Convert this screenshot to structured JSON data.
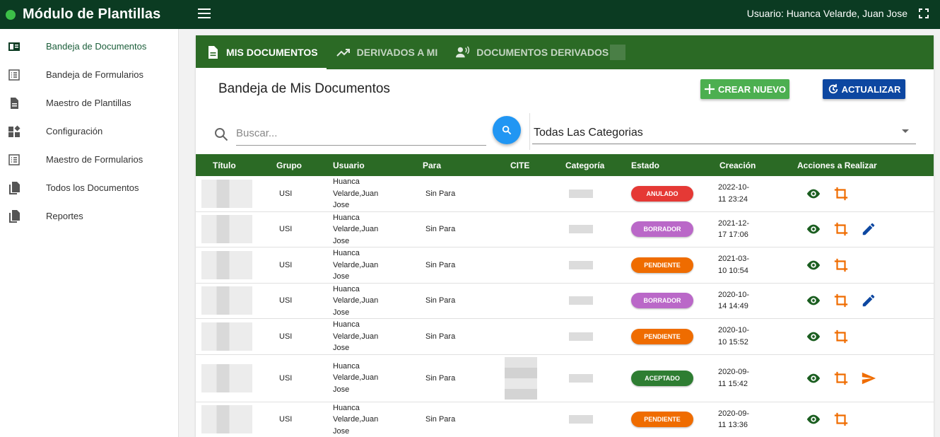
{
  "app": {
    "title": "Módulo de Plantillas",
    "user": "Usuario: Huanca Velarde, Juan Jose",
    "brand_color": "#0b3b22",
    "status_color": "#3cc048"
  },
  "sidebar": {
    "items": [
      {
        "label": "Bandeja de Documentos",
        "icon": "tray-icon",
        "active": true
      },
      {
        "label": "Bandeja de Formularios",
        "icon": "list-icon"
      },
      {
        "label": "Maestro de Plantillas",
        "icon": "document-icon"
      },
      {
        "label": "Configuración",
        "icon": "widgets-icon"
      },
      {
        "label": "Maestro de Formularios",
        "icon": "list-icon"
      },
      {
        "label": "Todos los Documentos",
        "icon": "copy-icon"
      },
      {
        "label": "Reportes",
        "icon": "copy-icon"
      }
    ]
  },
  "tabs": [
    {
      "label": "MIS DOCUMENTOS",
      "icon": "document-icon",
      "active": true
    },
    {
      "label": "DERIVADOS A MI",
      "icon": "trending-icon"
    },
    {
      "label": "DOCUMENTOS DERIVADOS",
      "icon": "voice-person-icon"
    }
  ],
  "main": {
    "title": "Bandeja de Mis Documentos",
    "new_button": "CREAR NUEVO",
    "refresh_button": "ACTUALIZAR",
    "search_placeholder": "Buscar...",
    "category_selected": "Todas Las Categorias"
  },
  "table": {
    "headers": [
      "Título",
      "Grupo",
      "Usuario",
      "Para",
      "CITE",
      "Categoría",
      "Estado",
      "Creación",
      "Acciones a Realizar"
    ],
    "rows": [
      {
        "grupo": "USI",
        "usuario": [
          "Huanca",
          "Velarde,Juan",
          "Jose"
        ],
        "para": "Sin Para",
        "estado": "ANULADO",
        "estado_color": "#e53935",
        "creacion": [
          "2022-10-",
          "11 23:24"
        ],
        "actions": [
          "eye",
          "crop"
        ]
      },
      {
        "grupo": "USI",
        "usuario": [
          "Huanca",
          "Velarde,Juan",
          "Jose"
        ],
        "para": "Sin Para",
        "estado": "BORRADOR",
        "estado_color": "#ba68c8",
        "creacion": [
          "2021-12-",
          "17 17:06"
        ],
        "actions": [
          "eye",
          "crop",
          "edit"
        ]
      },
      {
        "grupo": "USI",
        "usuario": [
          "Huanca",
          "Velarde,Juan",
          "Jose"
        ],
        "para": "Sin Para",
        "estado": "PENDIENTE",
        "estado_color": "#ef6c00",
        "creacion": [
          "2021-03-",
          "10 10:54"
        ],
        "actions": [
          "eye",
          "crop"
        ]
      },
      {
        "grupo": "USI",
        "usuario": [
          "Huanca",
          "Velarde,Juan",
          "Jose"
        ],
        "para": "Sin Para",
        "estado": "BORRADOR",
        "estado_color": "#ba68c8",
        "creacion": [
          "2020-10-",
          "14 14:49"
        ],
        "actions": [
          "eye",
          "crop",
          "edit"
        ]
      },
      {
        "grupo": "USI",
        "usuario": [
          "Huanca",
          "Velarde,Juan",
          "Jose"
        ],
        "para": "Sin Para",
        "estado": "PENDIENTE",
        "estado_color": "#ef6c00",
        "creacion": [
          "2020-10-",
          "10 15:52"
        ],
        "actions": [
          "eye",
          "crop"
        ]
      },
      {
        "grupo": "USI",
        "usuario": [
          "Huanca",
          "Velarde,Juan",
          "Jose"
        ],
        "para": "Sin Para",
        "estado": "ACEPTADO",
        "estado_color": "#2e7d32",
        "creacion": [
          "2020-09-",
          "11 15:42"
        ],
        "actions": [
          "eye",
          "crop",
          "send"
        ],
        "has_cite": true
      },
      {
        "grupo": "USI",
        "usuario": [
          "Huanca",
          "Velarde,Juan",
          "Jose"
        ],
        "para": "Sin Para",
        "estado": "PENDIENTE",
        "estado_color": "#ef6c00",
        "creacion": [
          "2020-09-",
          "11 13:36"
        ],
        "actions": [
          "eye",
          "crop"
        ]
      }
    ]
  }
}
